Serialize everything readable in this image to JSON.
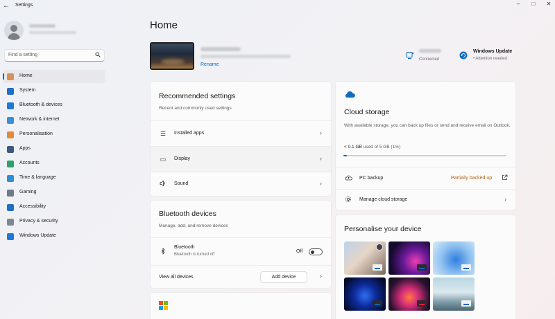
{
  "app": {
    "title": "Settings",
    "back_glyph": "←",
    "controls": {
      "minimize": "–",
      "maximize": "□",
      "close": "✕"
    }
  },
  "sidebar": {
    "search_placeholder": "Find a setting",
    "items": [
      {
        "label": "Home",
        "icon": "home-icon",
        "color": "#d99058",
        "active": true
      },
      {
        "label": "System",
        "icon": "system-icon",
        "color": "#1f6fc5"
      },
      {
        "label": "Bluetooth & devices",
        "icon": "bluetooth-icon",
        "color": "#1f7ad6"
      },
      {
        "label": "Network & internet",
        "icon": "network-icon",
        "color": "#3a8fd9"
      },
      {
        "label": "Personalisation",
        "icon": "brush-icon",
        "color": "#e08a3a"
      },
      {
        "label": "Apps",
        "icon": "apps-icon",
        "color": "#3c5a7d"
      },
      {
        "label": "Accounts",
        "icon": "accounts-icon",
        "color": "#2aa06b"
      },
      {
        "label": "Time & language",
        "icon": "globe-icon",
        "color": "#2d8fd6"
      },
      {
        "label": "Gaming",
        "icon": "gaming-icon",
        "color": "#6c7a89"
      },
      {
        "label": "Accessibility",
        "icon": "accessibility-icon",
        "color": "#1f6fc5"
      },
      {
        "label": "Privacy & security",
        "icon": "shield-icon",
        "color": "#7d8894"
      },
      {
        "label": "Windows Update",
        "icon": "update-icon",
        "color": "#1f7ad6"
      }
    ]
  },
  "header": {
    "title": "Home",
    "rename": "Rename",
    "connection_status": "Connected",
    "windows_update": {
      "title": "Windows Update",
      "status": "• Attention needed"
    }
  },
  "recommended": {
    "title": "Recommended settings",
    "subtitle": "Recent and commonly used settings",
    "rows": [
      {
        "label": "Installed apps",
        "icon": "apps-list-icon",
        "glyph": "☰"
      },
      {
        "label": "Display",
        "icon": "display-icon",
        "glyph": "▭"
      },
      {
        "label": "Sound",
        "icon": "speaker-icon",
        "glyph": "🔈"
      }
    ]
  },
  "bluetooth": {
    "title": "Bluetooth devices",
    "subtitle": "Manage, add, and remove devices",
    "device_label": "Bluetooth",
    "device_status": "Bluetooth is turned off",
    "toggle_state": "Off",
    "view_all": "View all devices",
    "add_device": "Add device"
  },
  "cloud": {
    "title": "Cloud storage",
    "description": "With available storage, you can back up files or send and receive email on Outlook.",
    "used": "< 0.1 GB",
    "used_of": "used of 5 GB (1%)",
    "used_fraction": 0.02,
    "pc_backup": "PC backup",
    "pc_backup_status": "Partially backed up",
    "manage": "Manage cloud storage",
    "accent": "#0f6cbd",
    "warning_color": "#b3620f"
  },
  "personalise": {
    "title": "Personalise your device",
    "wallpapers": [
      "wallpaper-1",
      "wallpaper-2",
      "wallpaper-3",
      "wallpaper-4",
      "wallpaper-5",
      "wallpaper-6"
    ]
  }
}
